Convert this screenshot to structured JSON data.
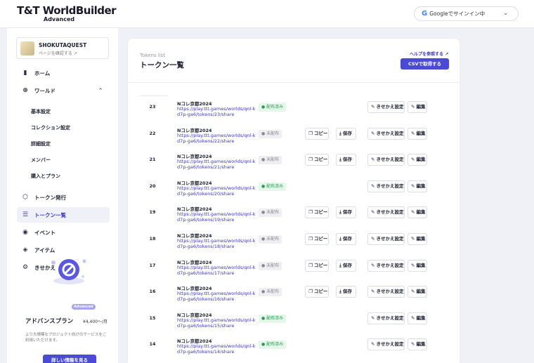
{
  "header": {
    "logo_main": "T&T WorldBuilder",
    "logo_sub": "Advanced",
    "google_signin": "Googleでサインイン中"
  },
  "sidebar": {
    "project_name": "SHOKUTAQUEST",
    "project_link": "ページを確認する",
    "nav": {
      "home": "ホーム",
      "world": "ワールド",
      "basic": "基本設定",
      "collection": "コレクション設定",
      "detail": "詳細設定",
      "member": "メンバー",
      "purchase": "購入とプラン",
      "token_issue": "トークン発行",
      "token_list": "トークン一覧",
      "event": "イベント",
      "item": "アイテム",
      "outfit": "きせかえ"
    },
    "promo": {
      "badge": "Advanced",
      "title": "アドバンスプラン",
      "price": "¥4,400〜/月",
      "desc": "より大規模なプロジェクト向けのサービスをご利用いただけます。",
      "button": "詳しい情報を見る"
    }
  },
  "main": {
    "subtitle": "Tokens list",
    "title": "トークン一覧",
    "help_link": "ヘルプを参照する",
    "csv_button": "CSVで取得する",
    "labels": {
      "copy": "コピー",
      "save": "保存",
      "outfit_setting": "きせかえ設定",
      "edit": "編集"
    },
    "rows": [
      {
        "id": "23",
        "name": "Nコレ京都2024",
        "url": "https://play.ttt.games/worlds/qnl-kd7p-ga6/tokens/23/share",
        "status": "配布済み"
      },
      {
        "id": "22",
        "name": "Nコレ京都2024",
        "url": "https://play.ttt.games/worlds/qnl-kd7p-ga6/tokens/22/share",
        "status": "未配布"
      },
      {
        "id": "21",
        "name": "Nコレ京都2024",
        "url": "https://play.ttt.games/worlds/qnl-kd7p-ga6/tokens/21/share",
        "status": "未配布"
      },
      {
        "id": "20",
        "name": "Nコレ京都2024",
        "url": "https://play.ttt.games/worlds/qnl-kd7p-ga6/tokens/20/share",
        "status": "配布済み"
      },
      {
        "id": "19",
        "name": "Nコレ京都2024",
        "url": "https://play.ttt.games/worlds/qnl-kd7p-ga6/tokens/19/share",
        "status": "未配布"
      },
      {
        "id": "18",
        "name": "Nコレ京都2024",
        "url": "https://play.ttt.games/worlds/qnl-kd7p-ga6/tokens/18/share",
        "status": "未配布"
      },
      {
        "id": "17",
        "name": "Nコレ京都2024",
        "url": "https://play.ttt.games/worlds/qnl-kd7p-ga6/tokens/17/share",
        "status": "未配布"
      },
      {
        "id": "16",
        "name": "Nコレ京都2024",
        "url": "https://play.ttt.games/worlds/qnl-kd7p-ga6/tokens/16/share",
        "status": "未配布"
      },
      {
        "id": "15",
        "name": "Nコレ京都2024",
        "url": "https://play.ttt.games/worlds/qnl-kd7p-ga6/tokens/15/share",
        "status": "配布済み"
      },
      {
        "id": "14",
        "name": "Nコレ京都2024",
        "url": "https://play.ttt.games/worlds/qnl-kd7p-ga6/tokens/14/share",
        "status": "配布済み"
      }
    ]
  },
  "colors": {
    "accent": "#4a4ad6",
    "published": "#2e9a52",
    "unpublished": "#888890"
  }
}
